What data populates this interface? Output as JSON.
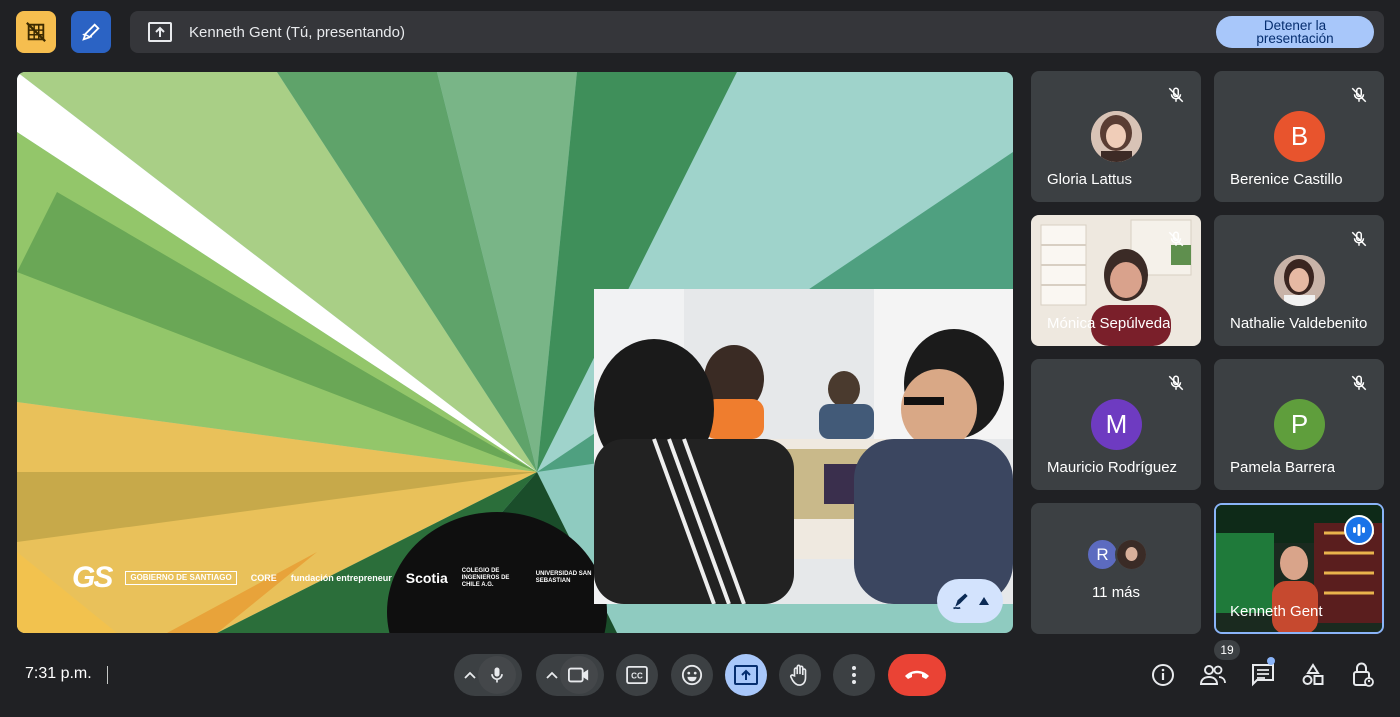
{
  "presentation_bar": {
    "text": "Kenneth Gent (Tú, presentando)",
    "stop_label": "Detener la presentación"
  },
  "slide": {
    "logo_gs": "GS",
    "logo_gobierno": "GOBIERNO DE SANTIAGO",
    "logo_core": "CORE",
    "logo_fundacion": "fundación entrepreneur",
    "logo_scotia": "Scotia",
    "logo_colegio": "COLEGIO DE INGENIEROS DE CHILE A.G.",
    "logo_usm": "UNIVERSIDAD SAN SEBASTIAN"
  },
  "participants": [
    {
      "name": "Gloria Lattus",
      "initial": "",
      "color": "#c9a999"
    },
    {
      "name": "Berenice Castillo",
      "initial": "B",
      "color": "#e8542d"
    },
    {
      "name": "Mónica Sepúlveda",
      "initial": "",
      "color": "#8c6d63"
    },
    {
      "name": "Nathalie Valdebenito",
      "initial": "",
      "color": "#b59285"
    },
    {
      "name": "Mauricio Rodríguez",
      "initial": "M",
      "color": "#6e3bc1"
    },
    {
      "name": "Pamela Barrera",
      "initial": "P",
      "color": "#5f9e3c"
    }
  ],
  "more_tile": {
    "initial": "R",
    "color": "#5c6bc0",
    "label": "11 más"
  },
  "self_tile": {
    "name": "Kenneth Gent"
  },
  "bottom": {
    "time": "7:31 p.m.",
    "people_count": "19"
  },
  "icons": {
    "no_captions_tile": "no-video-overlay-icon",
    "annotate": "pen-icon",
    "present": "present-screen-icon",
    "mic": "mic-icon",
    "camera": "camera-icon",
    "captions": "captions-icon",
    "emoji": "emoji-icon",
    "hand": "hand-icon",
    "more": "more-vert-icon",
    "leave": "call-end-icon",
    "info": "info-icon",
    "people": "people-icon",
    "chat": "chat-icon",
    "activities": "activities-icon",
    "lock": "host-controls-icon"
  }
}
